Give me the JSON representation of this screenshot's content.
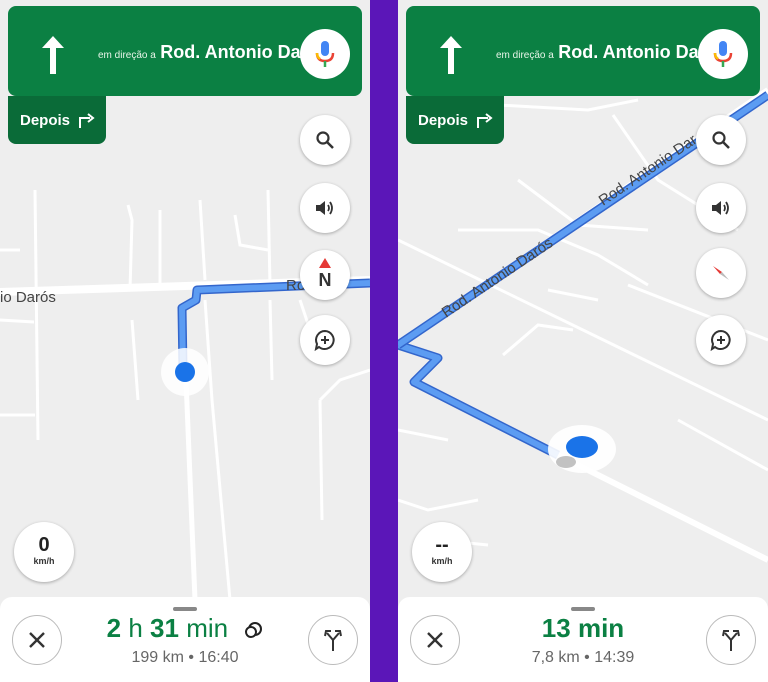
{
  "left": {
    "header": {
      "direction_pre": "em direção a",
      "road_name": "Rod. Antonio Darós",
      "arrow_icon": "straight-arrow-icon",
      "mic_icon": "microphone-icon"
    },
    "then": {
      "label": "Depois",
      "icon": "turn-right-icon"
    },
    "map_labels": {
      "road_left": "io Darós",
      "road_right": "Rod.             on"
    },
    "compass": {
      "label": "N"
    },
    "speed": {
      "value": "0",
      "unit": "km/h"
    },
    "bottom": {
      "hours": "2",
      "hours_unit": "h",
      "minutes": "31",
      "minutes_unit": "min",
      "distance": "199 km",
      "separator": "•",
      "arrival": "16:40"
    }
  },
  "right": {
    "header": {
      "direction_pre": "em direção a",
      "road_name": "Rod. Antonio Darós",
      "arrow_icon": "straight-arrow-icon",
      "mic_icon": "microphone-icon"
    },
    "then": {
      "label": "Depois",
      "icon": "turn-right-icon"
    },
    "map_labels": {
      "road_a": "Rod. Antonio Darós",
      "road_b": "Rod. Antonio Dar"
    },
    "speed": {
      "value": "--",
      "unit": "km/h"
    },
    "bottom": {
      "minutes": "13",
      "minutes_unit": "min",
      "distance": "7,8 km",
      "separator": "•",
      "arrival": "14:39"
    }
  },
  "colors": {
    "header_green": "#0b8043",
    "then_green": "#0a6b38",
    "route_blue": "#4a8fe8",
    "location_blue": "#1a73e8",
    "divider_purple": "#5b16b8",
    "eta_green": "#0b8043"
  }
}
